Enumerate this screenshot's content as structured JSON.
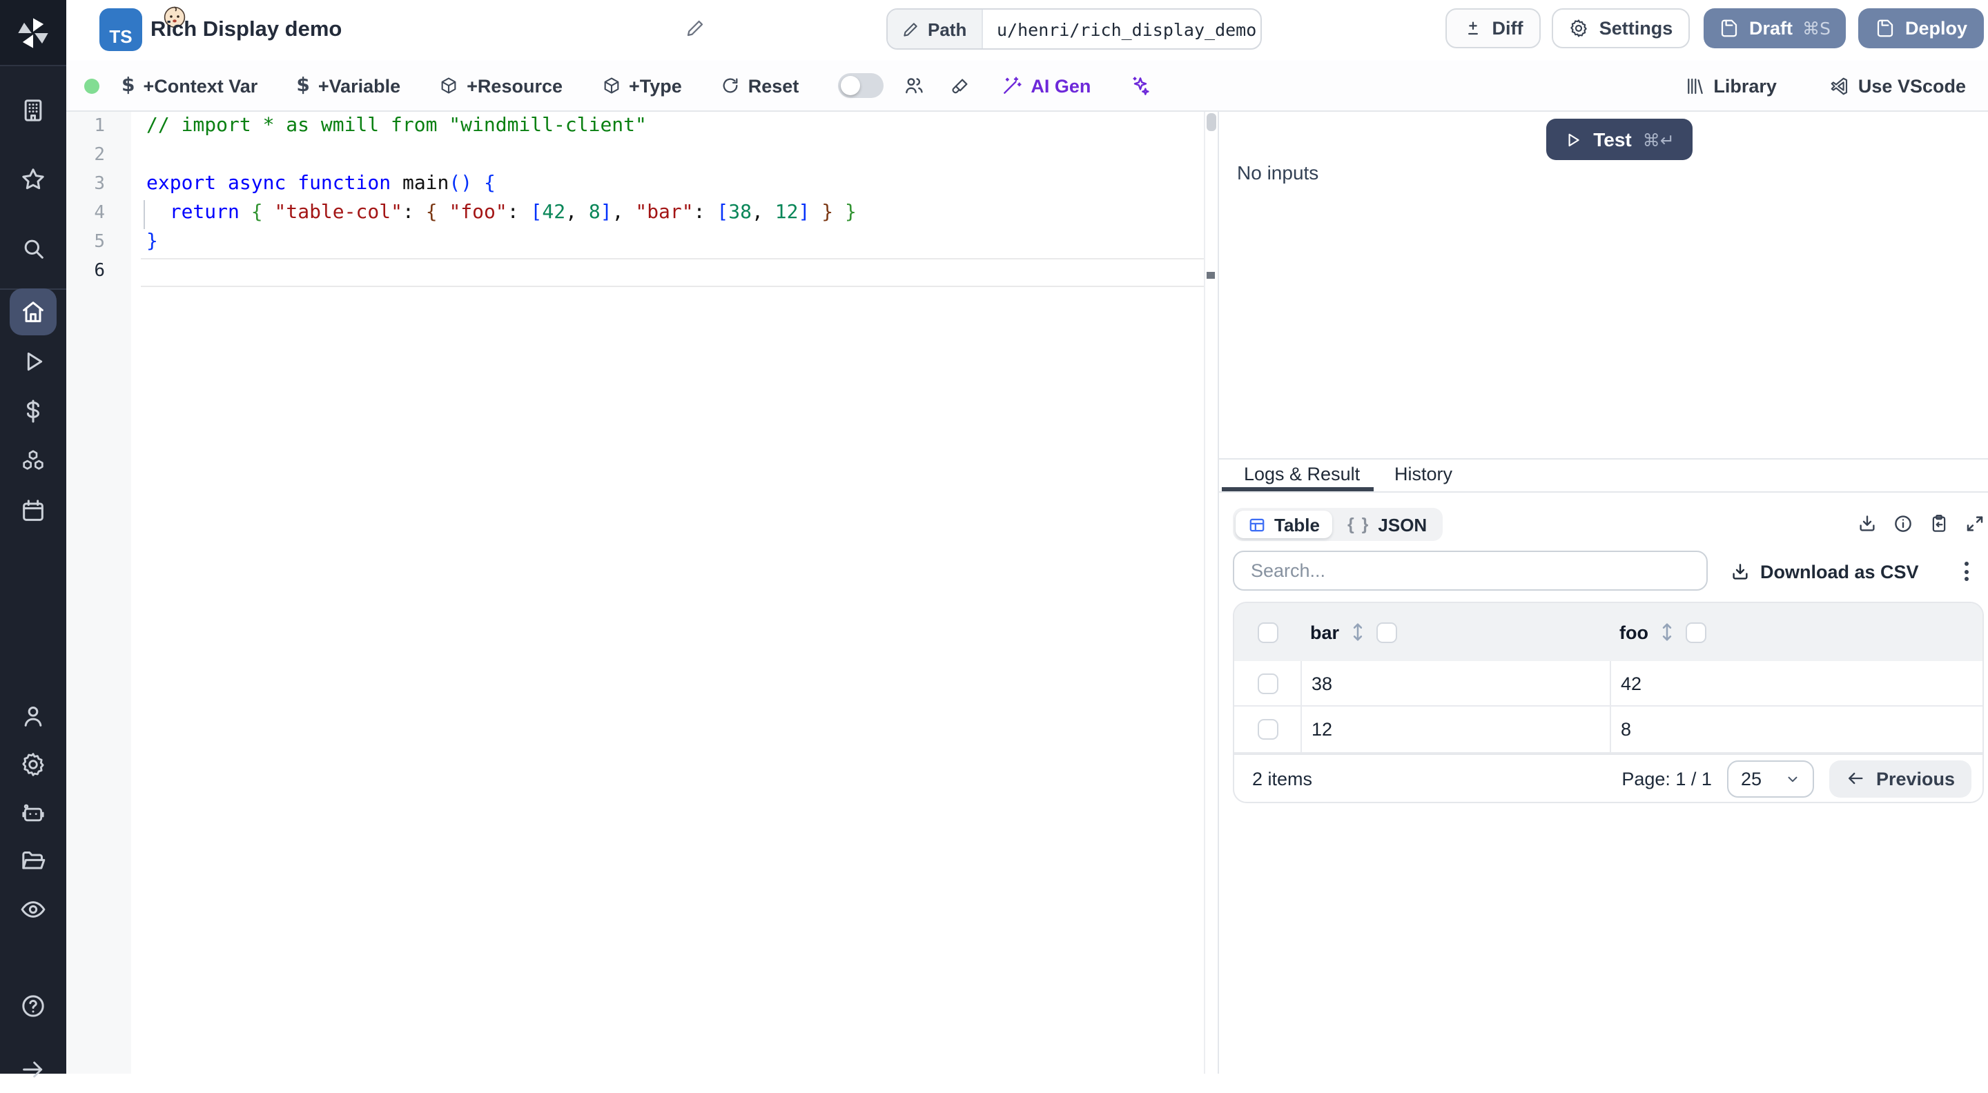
{
  "window": {
    "title": "Rich Display demo",
    "language_badge": "TS"
  },
  "header": {
    "path_label": "Path",
    "path_value": "u/henri/rich_display_demo",
    "diff_label": "Diff",
    "settings_label": "Settings",
    "draft_label": "Draft",
    "draft_shortcut": "⌘S",
    "deploy_label": "Deploy"
  },
  "toolbar": {
    "context_var": "+Context Var",
    "variable": "+Variable",
    "resource": "+Resource",
    "type": "+Type",
    "reset": "Reset",
    "ai_gen": "AI Gen",
    "library": "Library",
    "use_vscode": "Use VScode"
  },
  "sidebar": {
    "items": [
      "workspace",
      "favorites",
      "search",
      "home",
      "runs",
      "variables",
      "resources",
      "schedules",
      "users",
      "settings",
      "workers",
      "folders",
      "audit-logs",
      "help",
      "collapse"
    ]
  },
  "editor": {
    "line_numbers": [
      "1",
      "2",
      "3",
      "4",
      "5",
      "6"
    ],
    "current_line": 6,
    "colors": {
      "comment": "#0a8012",
      "kw": "#0000ff",
      "plain": "#111111",
      "str": "#a31515",
      "num": "#098658",
      "b1": "#0431fa",
      "b2": "#319331",
      "b3": "#7b3814"
    },
    "lines": [
      [
        [
          "// import * as wmill from \"windmill-client\"",
          "comment"
        ]
      ],
      [],
      [
        [
          "export",
          "kw"
        ],
        [
          " ",
          "plain"
        ],
        [
          "async",
          "kw"
        ],
        [
          " ",
          "plain"
        ],
        [
          "function",
          "kw"
        ],
        [
          " ",
          "plain"
        ],
        [
          "main",
          "plain"
        ],
        [
          "()",
          "b1"
        ],
        [
          " ",
          "plain"
        ],
        [
          "{",
          "b1"
        ]
      ],
      [
        [
          "  ",
          "plain"
        ],
        [
          "return",
          "kw"
        ],
        [
          " ",
          "plain"
        ],
        [
          "{",
          "b2"
        ],
        [
          " ",
          "plain"
        ],
        [
          "\"table-col\"",
          "str"
        ],
        [
          ":",
          "plain"
        ],
        [
          " ",
          "plain"
        ],
        [
          "{",
          "b3"
        ],
        [
          " ",
          "plain"
        ],
        [
          "\"foo\"",
          "str"
        ],
        [
          ":",
          "plain"
        ],
        [
          " ",
          "plain"
        ],
        [
          "[",
          "b1"
        ],
        [
          "42",
          "num"
        ],
        [
          ",",
          "plain"
        ],
        [
          " ",
          "plain"
        ],
        [
          "8",
          "num"
        ],
        [
          "]",
          "b1"
        ],
        [
          ",",
          "plain"
        ],
        [
          " ",
          "plain"
        ],
        [
          "\"bar\"",
          "str"
        ],
        [
          ":",
          "plain"
        ],
        [
          " ",
          "plain"
        ],
        [
          "[",
          "b1"
        ],
        [
          "38",
          "num"
        ],
        [
          ",",
          "plain"
        ],
        [
          " ",
          "plain"
        ],
        [
          "12",
          "num"
        ],
        [
          "]",
          "b1"
        ],
        [
          " ",
          "plain"
        ],
        [
          "}",
          "b3"
        ],
        [
          " ",
          "plain"
        ],
        [
          "}",
          "b2"
        ]
      ],
      [
        [
          "}",
          "b1"
        ]
      ],
      []
    ]
  },
  "run_panel": {
    "test_label": "Test",
    "test_shortcut": "⌘↵",
    "no_inputs": "No inputs"
  },
  "result_panel": {
    "tabs": [
      {
        "label": "Logs & Result",
        "active": true
      },
      {
        "label": "History",
        "active": false
      }
    ],
    "view_toggle": {
      "table_label": "Table",
      "json_label": "JSON",
      "json_glyph": "{ }"
    },
    "search_placeholder": "Search...",
    "download_csv_label": "Download as CSV",
    "table": {
      "columns": [
        "bar",
        "foo"
      ],
      "rows": [
        {
          "bar": "38",
          "foo": "42"
        },
        {
          "bar": "12",
          "foo": "8"
        }
      ],
      "items_label": "2 items",
      "page_label": "Page: 1 / 1",
      "page_size": "25",
      "previous_label": "Previous"
    }
  },
  "colors": {
    "ts_badge_blue": "#3178c6",
    "slate_button": "#6e83a7",
    "test_button_navy": "#3b4764",
    "active_nav_bg": "#45516e",
    "ai_purple": "#6d28d9",
    "status_green": "#82dd93",
    "table_icon_blue": "#3d6ef5"
  }
}
